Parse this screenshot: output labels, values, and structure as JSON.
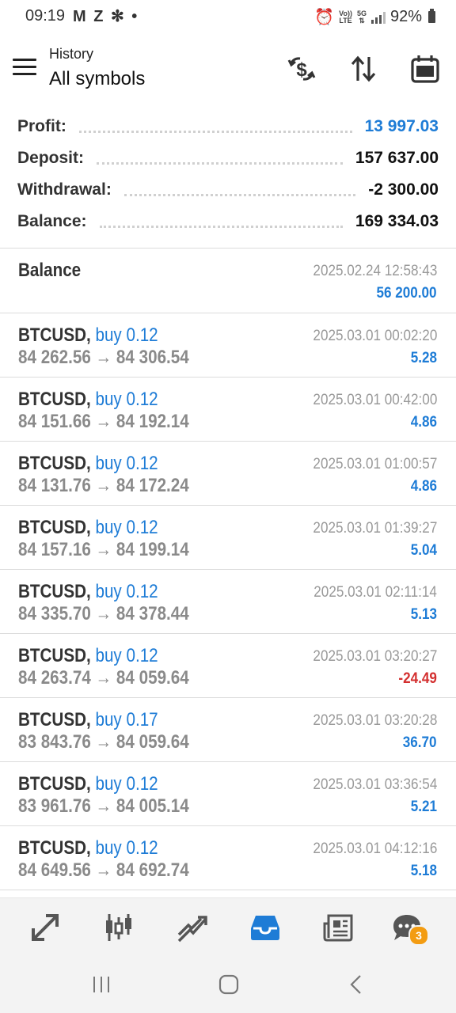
{
  "status": {
    "time": "09:19",
    "left_icons": "M Z ✻ •",
    "net_top": "Vo))",
    "net_bottom": "LTE",
    "gen_top": "5G",
    "battery": "92%"
  },
  "header": {
    "subtitle": "History",
    "title": "All symbols"
  },
  "summary": {
    "profit_label": "Profit:",
    "profit_value": "13 997.03",
    "deposit_label": "Deposit:",
    "deposit_value": "157 637.00",
    "withdrawal_label": "Withdrawal:",
    "withdrawal_value": "-2 300.00",
    "balance_label": "Balance:",
    "balance_value": "169 334.03"
  },
  "balance_op": {
    "label": "Balance",
    "time": "2025.02.24 12:58:43",
    "amount": "56 200.00"
  },
  "deals": [
    {
      "symbol": "BTCUSD,",
      "side": "buy 0.12",
      "prices": "84 262.56 → 84 306.54",
      "time": "2025.03.01 00:02:20",
      "profit": "5.28"
    },
    {
      "symbol": "BTCUSD,",
      "side": "buy 0.12",
      "prices": "84 151.66 → 84 192.14",
      "time": "2025.03.01 00:42:00",
      "profit": "4.86"
    },
    {
      "symbol": "BTCUSD,",
      "side": "buy 0.12",
      "prices": "84 131.76 → 84 172.24",
      "time": "2025.03.01 01:00:57",
      "profit": "4.86"
    },
    {
      "symbol": "BTCUSD,",
      "side": "buy 0.12",
      "prices": "84 157.16 → 84 199.14",
      "time": "2025.03.01 01:39:27",
      "profit": "5.04"
    },
    {
      "symbol": "BTCUSD,",
      "side": "buy 0.12",
      "prices": "84 335.70 → 84 378.44",
      "time": "2025.03.01 02:11:14",
      "profit": "5.13"
    },
    {
      "symbol": "BTCUSD,",
      "side": "buy 0.12",
      "prices": "84 263.74 → 84 059.64",
      "time": "2025.03.01 03:20:27",
      "profit": "-24.49"
    },
    {
      "symbol": "BTCUSD,",
      "side": "buy 0.17",
      "prices": "83 843.76 → 84 059.64",
      "time": "2025.03.01 03:20:28",
      "profit": "36.70"
    },
    {
      "symbol": "BTCUSD,",
      "side": "buy 0.12",
      "prices": "83 961.76 → 84 005.14",
      "time": "2025.03.01 03:36:54",
      "profit": "5.21"
    },
    {
      "symbol": "BTCUSD,",
      "side": "buy 0.12",
      "prices": "84 649.56 → 84 692.74",
      "time": "2025.03.01 04:12:16",
      "profit": "5.18"
    }
  ],
  "bottom_nav": {
    "items": [
      "quotes-icon",
      "chart-icon",
      "trade-icon",
      "history-icon",
      "news-icon",
      "messages-icon"
    ],
    "active": "history-icon",
    "messages_badge": "3"
  },
  "colors": {
    "accent": "#1e7cd6",
    "loss": "#d32f2f",
    "badge": "#f39c12"
  }
}
